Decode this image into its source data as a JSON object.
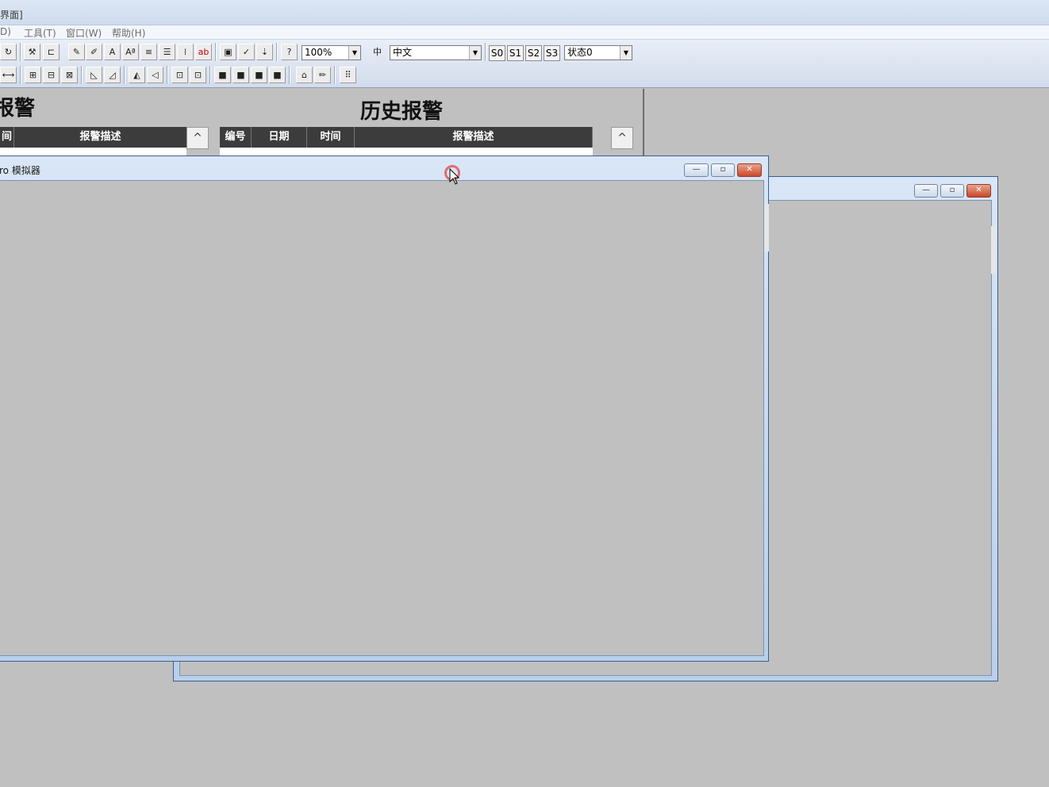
{
  "app": {
    "title": "界面]"
  },
  "menu": [
    {
      "label": "D)"
    },
    {
      "label": "工具(T)"
    },
    {
      "label": "窗口(W)"
    },
    {
      "label": "帮助(H)"
    }
  ],
  "toolbar": {
    "zoom_value": "100%",
    "language_value": "中文",
    "state_buttons": [
      "S0",
      "S1",
      "S2",
      "S3"
    ],
    "state_value": "状态0"
  },
  "realtime_alarm": {
    "title_fragment": "报警",
    "headers": [
      "间",
      "报警描述"
    ]
  },
  "history_alarm": {
    "title": "历史报警",
    "headers": [
      "编号",
      "日期",
      "时间",
      "报警描述"
    ]
  },
  "simulator_window": {
    "title": "ro 模拟器"
  },
  "colors": {
    "accent_close": "#c9472a",
    "table_header": "#3c3c3c",
    "background": "#c0c0c0"
  }
}
